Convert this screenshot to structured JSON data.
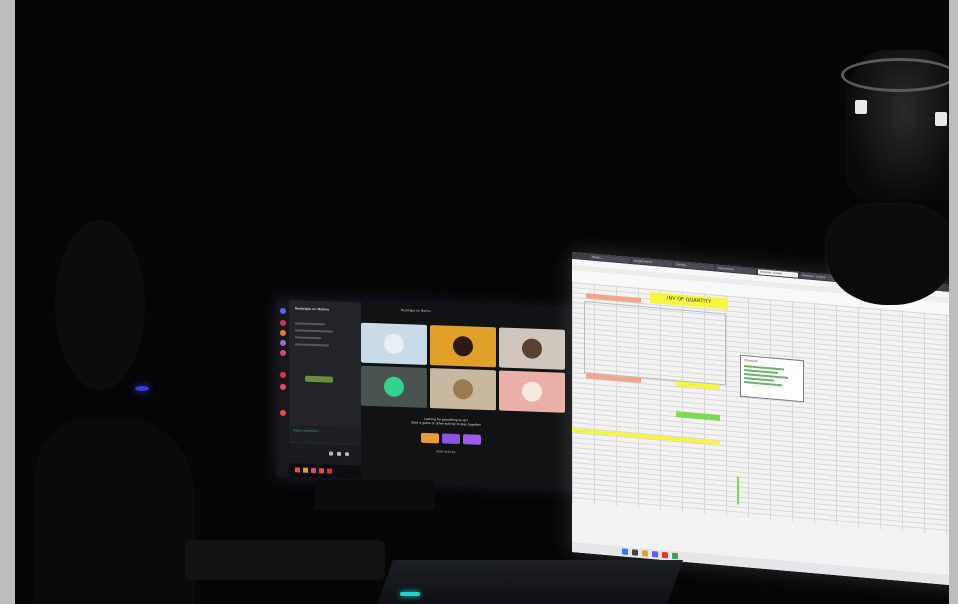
{
  "scene": {
    "description_colors": {
      "frame": "#bdbdbd",
      "room": "#050505",
      "sheet_yellow": "#f5f542",
      "sheet_salmon": "#f2a58a",
      "sheet_green": "#7ed957",
      "keyboard_light": "#1fd0d0",
      "pc_light": "#3b3bdc"
    }
  },
  "left_monitor": {
    "app": "discord",
    "server_title": "Nostalgia no Mahiru",
    "call_title": "Nostalgia no Mahiru",
    "tiles": [
      {
        "bg": "#c9dbe9",
        "avatar": "#e8f0f7"
      },
      {
        "bg": "#e0a02a",
        "avatar": "#2a1a12"
      },
      {
        "bg": "#cfc7bd",
        "avatar": "#5a4032"
      },
      {
        "bg": "#4b5350",
        "avatar": "#2fd38d"
      },
      {
        "bg": "#c9b8a0",
        "avatar": "#9a7a52"
      },
      {
        "bg": "#eab0a8",
        "avatar": "#f7e8e0"
      }
    ],
    "caption_line1": "Looking for something to do?",
    "caption_line2": "Start a game or other activity to play together",
    "caption_footer": "Start Activity",
    "user_line": "Voice Connected",
    "icons": [
      "home-icon",
      "server-icon",
      "mic-icon",
      "headphones-icon",
      "settings-icon"
    ]
  },
  "right_monitor": {
    "app": "google-sheets",
    "tabs": [
      "Sheets",
      "Google Sheets",
      "Untitled",
      "Dokumentos",
      "Shipping - Google",
      "Inventory - Google"
    ],
    "sheet_title": "INV OF QUANTITY",
    "popup_label": "Checklist"
  }
}
